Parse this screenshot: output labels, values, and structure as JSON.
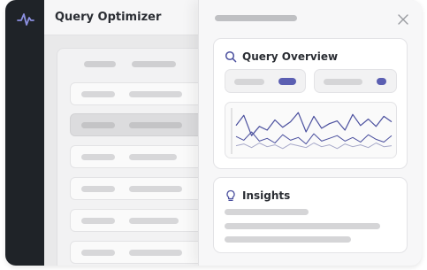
{
  "app": {
    "title": "Query Optimizer"
  },
  "nav": {
    "logo_icon": "pulse-icon"
  },
  "panel": {
    "close_icon": "close-icon",
    "overview": {
      "title": "Query Overview",
      "icon": "search-icon"
    },
    "insights": {
      "title": "Insights",
      "icon": "lightbulb-icon"
    }
  },
  "colors": {
    "accent": "#5b5fb2",
    "rail": "#1f2328",
    "chart_primary": "#4a4f9e",
    "chart_secondary": "#a7a9c9"
  },
  "chart_data": {
    "type": "line",
    "title": "",
    "xlabel": "",
    "ylabel": "",
    "grid": false,
    "legend": "none",
    "ylim": [
      0,
      100
    ],
    "x": [
      1,
      2,
      3,
      4,
      5,
      6,
      7,
      8,
      9,
      10,
      11,
      12,
      13,
      14,
      15,
      16,
      17,
      18,
      19,
      20,
      21
    ],
    "series": [
      {
        "values": [
          62,
          84,
          40,
          60,
          52,
          74,
          58,
          70,
          90,
          48,
          82,
          56,
          66,
          72,
          52,
          86,
          62,
          76,
          60,
          82,
          70
        ]
      },
      {
        "values": [
          38,
          30,
          48,
          28,
          34,
          24,
          42,
          30,
          36,
          22,
          44,
          28,
          34,
          40,
          28,
          36,
          26,
          42,
          32,
          26,
          40
        ]
      },
      {
        "values": [
          18,
          22,
          14,
          24,
          16,
          20,
          12,
          22,
          18,
          14,
          24,
          16,
          20,
          12,
          22,
          16,
          20,
          14,
          24,
          16,
          18
        ]
      }
    ]
  }
}
